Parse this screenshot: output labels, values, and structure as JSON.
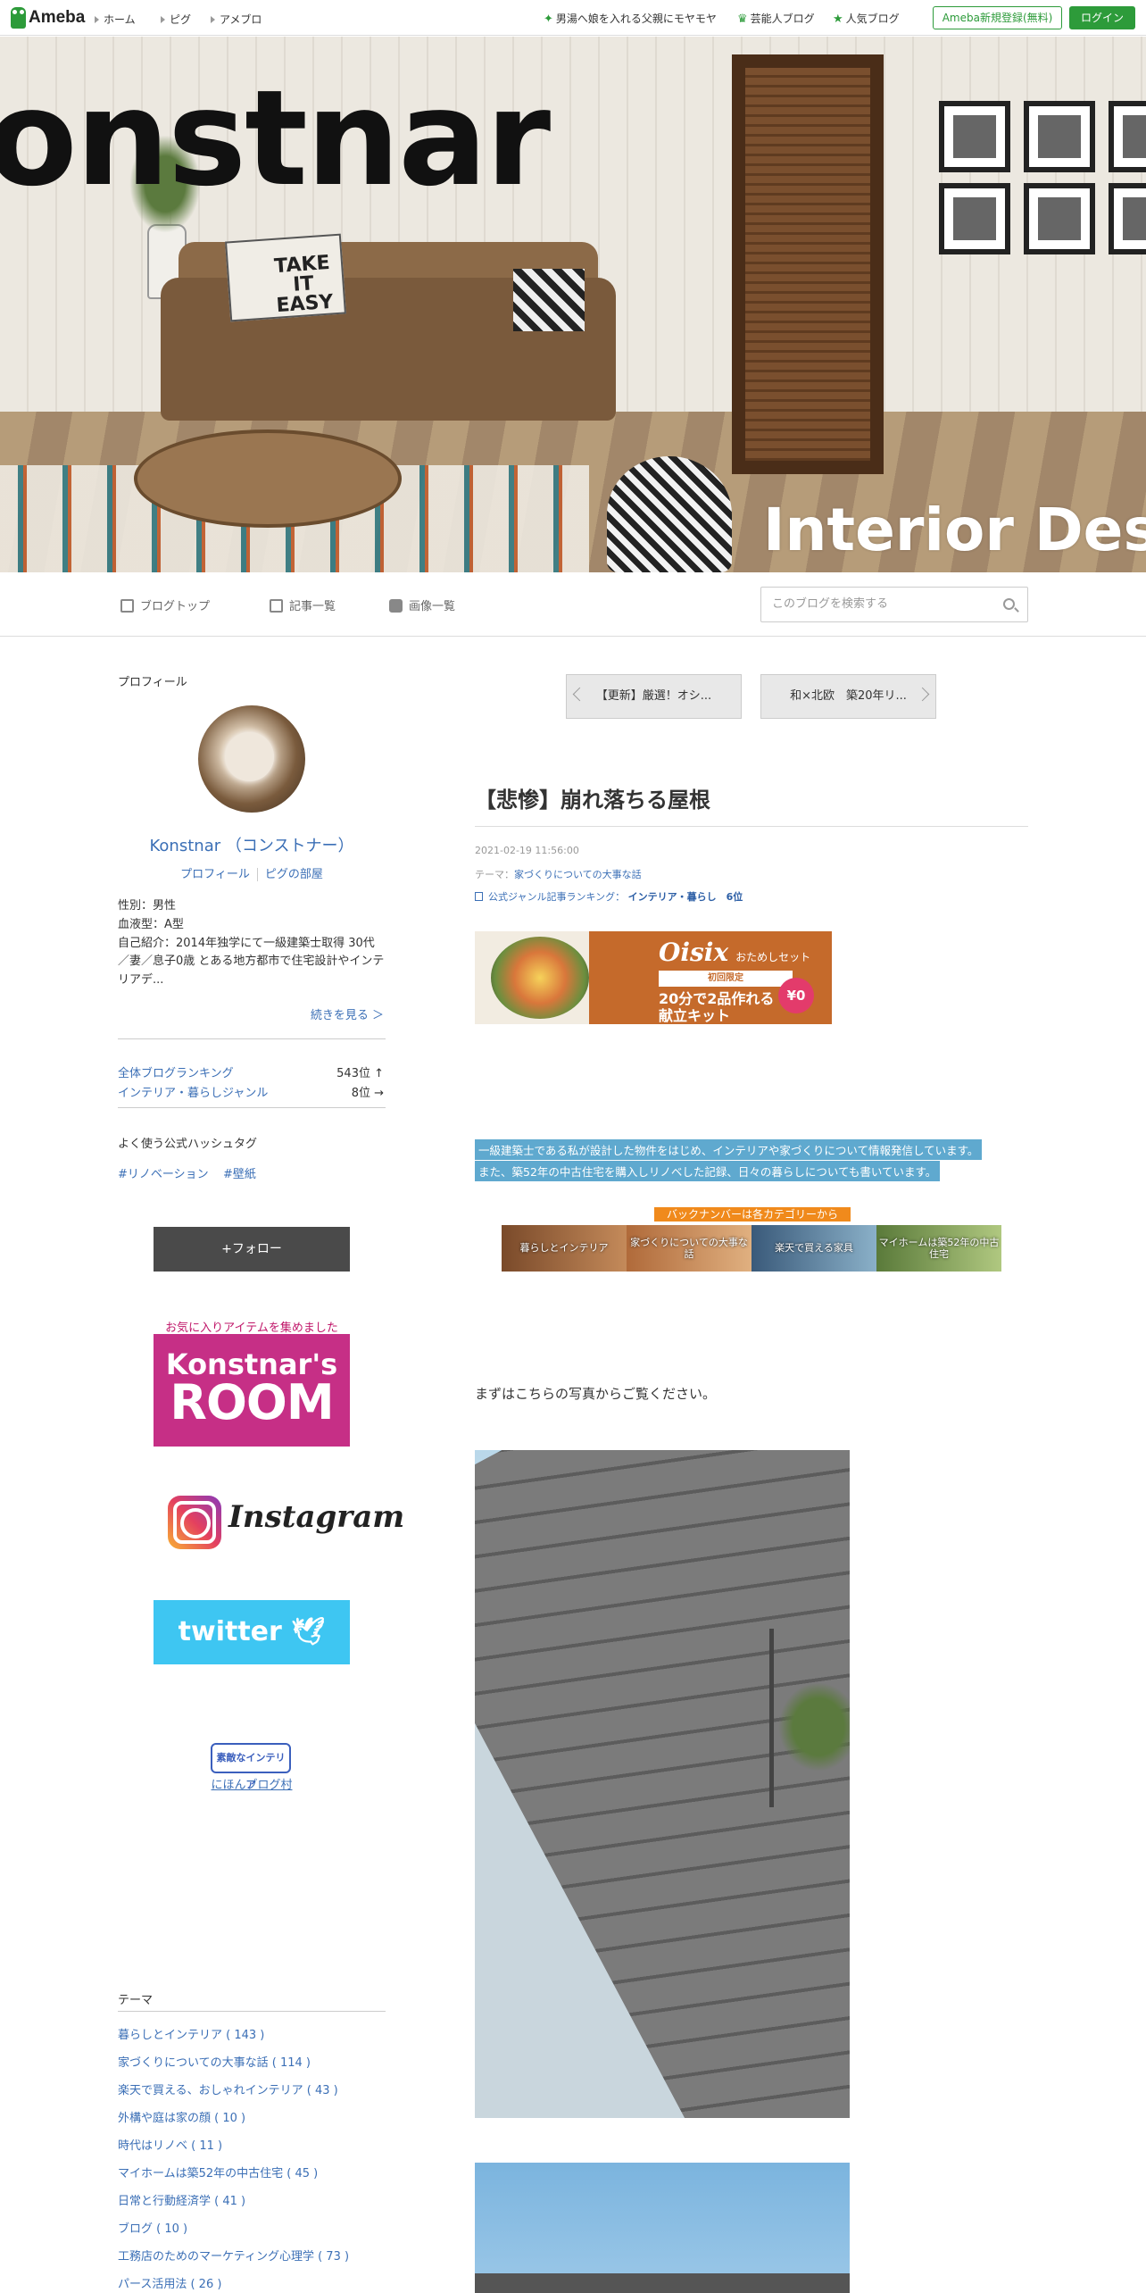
{
  "topbar": {
    "logo": "Ameba",
    "nav": [
      "ホーム",
      "ピグ",
      "アメブロ"
    ],
    "links": [
      {
        "icon": "star-icon",
        "label": "男湯へ娘を入れる父親にモヤモヤ"
      },
      {
        "icon": "crown-icon",
        "label": "芸能人ブログ"
      },
      {
        "icon": "star-icon",
        "label": "人気ブログ"
      }
    ],
    "register": "Ameba新規登録(無料)",
    "login": "ログイン"
  },
  "header": {
    "title": "onstnar",
    "subtitle": "Interior Des",
    "pillow_text": "TAKE IT EASY"
  },
  "blognav": {
    "top": "ブログトップ",
    "entries": "記事一覧",
    "images": "画像一覧",
    "search_placeholder": "このブログを検索する"
  },
  "sidebar": {
    "profile_heading": "プロフィール",
    "name": "Konstnar （コンストナー）",
    "profile_link": "プロフィール",
    "pigg_link": "ピグの部屋",
    "info": [
      "性別：男性",
      "血液型：A型",
      "自己紹介：2014年独学にて一級建築士取得 30代／妻／息子0歳 とある地方都市で住宅設計やインテリアデ..."
    ],
    "more": "続きを見る ＞",
    "rankings": [
      {
        "label": "全体ブログランキング",
        "value": "543位 ↑"
      },
      {
        "label": "インテリア・暮らしジャンル",
        "value": "8位 →"
      }
    ],
    "hashtag_heading": "よく使う公式ハッシュタグ",
    "hashtags": [
      "#リノベーション",
      "#壁紙"
    ],
    "follow": "+フォロー",
    "fav_text": "お気に入りアイテムを集めました",
    "room_line1": "Konstnar's",
    "room_line2": "ROOM",
    "instagram": "Instagram",
    "twitter": "twitter",
    "nihon_badge": "素敵なインテリア",
    "nihon_link": "にほんブログ村",
    "theme_heading": "テーマ",
    "themes": [
      "暮らしとインテリア ( 143 )",
      "家づくりについての大事な話 ( 114 )",
      "楽天で買える、おしゃれインテリア ( 43 )",
      "外構や庭は家の顔 ( 10 )",
      "時代はリノベ ( 11 )",
      "マイホームは築52年の中古住宅 ( 45 )",
      "日常と行動経済学 ( 41 )",
      "ブログ ( 10 )",
      "工務店のためのマーケティング心理学 ( 73 )",
      "パース活用法 ( 26 )"
    ]
  },
  "article": {
    "prev": "【更新】厳選！オシ...",
    "next": "和×北欧　築20年リ...",
    "title": "【悲惨】崩れ落ちる屋根",
    "date": "2021-02-19 11:56:00",
    "theme_label": "テーマ：",
    "theme": "家づくりについての大事な話",
    "ranking_label": "公式ジャンル記事ランキング：",
    "ranking": "インテリア・暮らし　6位",
    "ad": {
      "brand": "Oisix",
      "set": "おためしセット",
      "limited": "初回限定",
      "copy1": "20分で2品作れる",
      "copy2": "献立キット",
      "price": "¥0"
    },
    "intro1": "一級建築士である私が設計した物件をはじめ、インテリアや家づくりについて情報発信しています。",
    "intro2": "また、築52年の中古住宅を購入しリノベした記録、日々の暮らしについても書いています。",
    "backnumber": "バックナンバーは各カテゴリーから",
    "categories": [
      "暮らしとインテリア",
      "家づくりについての大事な話",
      "楽天で買える家具",
      "マイホームは築52年の中古住宅"
    ],
    "body1": "まずはこちらの写真からご覧ください。"
  }
}
